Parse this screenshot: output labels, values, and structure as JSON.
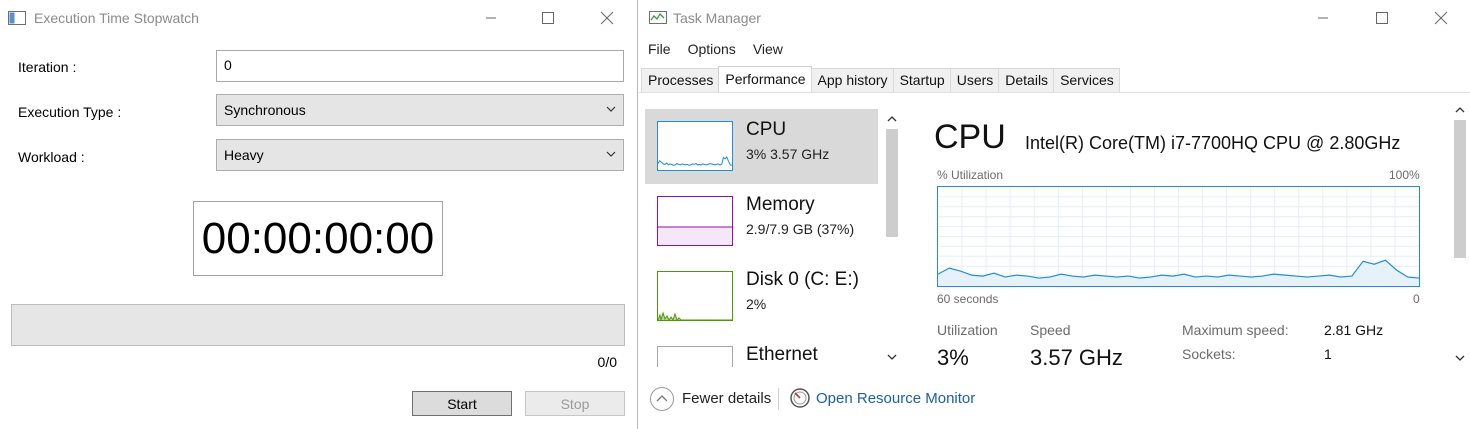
{
  "stopwatch": {
    "title": "Execution Time Stopwatch",
    "iteration_label": "Iteration :",
    "iteration_value": "0",
    "exec_type_label": "Execution Type :",
    "exec_type_value": "Synchronous",
    "workload_label": "Workload :",
    "workload_value": "Heavy",
    "timer": "00:00:00:00",
    "progress_fraction": 0,
    "counter": "0/0",
    "start_label": "Start",
    "stop_label": "Stop"
  },
  "taskmanager": {
    "title": "Task Manager",
    "menu": [
      "File",
      "Options",
      "View"
    ],
    "tabs": [
      "Processes",
      "Performance",
      "App history",
      "Startup",
      "Users",
      "Details",
      "Services"
    ],
    "active_tab": "Performance",
    "resources": [
      {
        "name": "CPU",
        "value": "3%  3.57 GHz",
        "color": "#1f8fd4"
      },
      {
        "name": "Memory",
        "value": "2.9/7.9 GB (37%)",
        "color": "#8b12ae"
      },
      {
        "name": "Disk 0 (C: E:)",
        "value": "2%",
        "color": "#4d9a06"
      },
      {
        "name": "Ethernet",
        "value": "",
        "color": "#a7a7a7"
      }
    ],
    "detail": {
      "heading": "CPU",
      "model": "Intel(R) Core(TM) i7-7700HQ CPU @ 2.80GHz",
      "graph_label": "% Utilization",
      "graph_max": "100%",
      "graph_time": "60 seconds",
      "graph_zero": "0",
      "utilization_label": "Utilization",
      "utilization_value": "3%",
      "speed_label": "Speed",
      "speed_value": "3.57 GHz",
      "max_speed_label": "Maximum speed:",
      "max_speed_value": "2.81 GHz",
      "sockets_label": "Sockets:",
      "sockets_value": "1",
      "utilization_history": [
        12,
        18,
        15,
        11,
        10,
        13,
        9,
        11,
        10,
        8,
        9,
        12,
        10,
        9,
        11,
        10,
        9,
        10,
        8,
        9,
        11,
        10,
        12,
        9,
        10,
        9,
        11,
        10,
        9,
        10,
        12,
        11,
        10,
        9,
        10,
        11,
        9,
        10,
        25,
        22,
        26,
        16,
        9,
        8
      ]
    },
    "footer": {
      "fewer_details": "Fewer details",
      "resource_monitor": "Open Resource Monitor"
    }
  }
}
